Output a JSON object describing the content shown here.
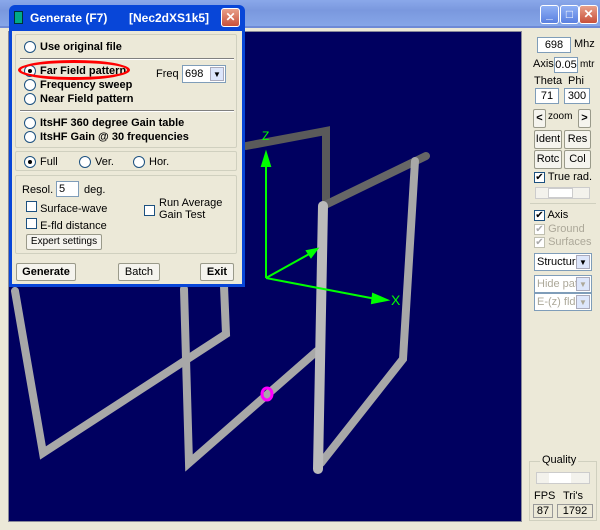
{
  "window": {
    "minimize": "_",
    "maximize": "□",
    "close": "✕"
  },
  "dialog": {
    "title": "Generate (F7)",
    "subtitle": "[Nec2dXS1k5]",
    "close": "✕",
    "options": [
      {
        "label": "Use original file",
        "selected": false
      },
      {
        "label": "Far Field pattern",
        "selected": true
      },
      {
        "label": "Frequency sweep",
        "selected": false
      },
      {
        "label": "Near Field pattern",
        "selected": false
      },
      {
        "label": "ItsHF 360 degree Gain table",
        "selected": false
      },
      {
        "label": "ItsHF Gain @ 30 frequencies",
        "selected": false
      }
    ],
    "freq_label": "Freq :",
    "freq_value": "698",
    "plane": [
      {
        "label": "Full",
        "selected": true
      },
      {
        "label": "Ver.",
        "selected": false
      },
      {
        "label": "Hor.",
        "selected": false
      }
    ],
    "resol_label": "Resol.",
    "resol_value": "5",
    "resol_unit": "deg.",
    "surface_wave": "Surface-wave",
    "efld_distance": "E-fld distance",
    "run_average": "Run Average",
    "gain_test": "Gain Test",
    "expert_settings": "Expert settings",
    "generate": "Generate",
    "batch": "Batch",
    "exit": "Exit",
    "highlight_color": "#ff0000"
  },
  "view": {
    "axis_x": "X",
    "axis_z": "Z",
    "background": "#000060",
    "axis_color": "#00ff00",
    "source_color": "#ff00ff"
  },
  "panel": {
    "freq": "698",
    "freq_unit": "Mhz",
    "axis_label": "Axis",
    "axis_value": "0.05",
    "axis_unit": "mtr",
    "theta_label": "Theta",
    "phi_label": "Phi",
    "theta": "71",
    "phi": "300",
    "zoom_prev": "<",
    "zoom": "zoom",
    "zoom_next": ">",
    "ident": "Ident",
    "res": "Res",
    "rotc": "Rotc",
    "col": "Col",
    "true_rad": "True rad.",
    "true_rad_checked": true,
    "axis_chk": "Axis",
    "ground": "Ground",
    "surfaces": "Surfaces",
    "structure": "Structure",
    "hide_patt": "Hide patt.",
    "efld": "E-(z) fld",
    "quality": "Quality",
    "fps_label": "FPS",
    "tris_label": "Tri's",
    "fps": "87",
    "tris": "1792"
  }
}
